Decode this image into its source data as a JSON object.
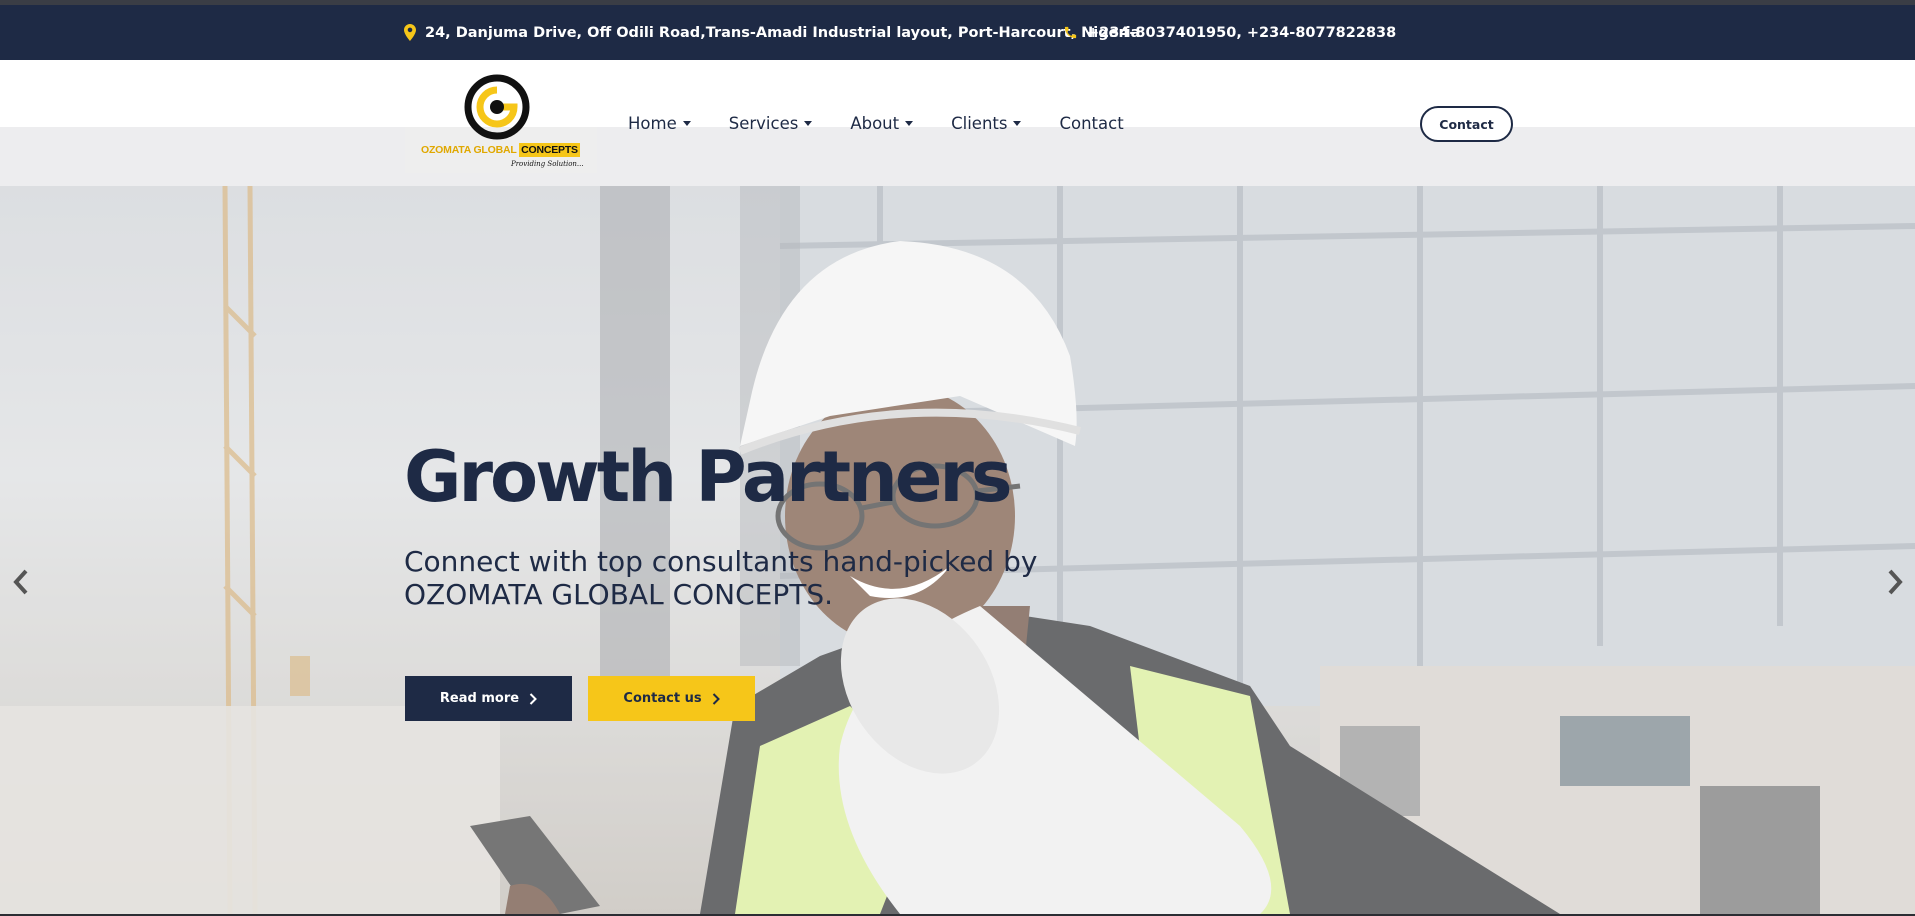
{
  "topbar": {
    "address": "24, Danjuma Drive, Off Odili Road,Trans-Amadi Industrial layout, Port-Harcourt, Nigeria",
    "address_icon": "map-pin-icon",
    "phone": "+234-8037401950, +234-8077822838",
    "phone_icon": "phone-icon"
  },
  "logo": {
    "name_part1": "OZOMATA GLOBAL ",
    "name_part2": "CONCEPTS",
    "tagline": "Providing Solution..."
  },
  "nav": {
    "items": [
      {
        "label": "Home",
        "dropdown": true
      },
      {
        "label": "Services",
        "dropdown": true
      },
      {
        "label": "About",
        "dropdown": true
      },
      {
        "label": "Clients",
        "dropdown": true
      },
      {
        "label": "Contact",
        "dropdown": false
      }
    ],
    "cta_label": "Contact"
  },
  "hero": {
    "title": "Growth Partners",
    "subtitle": "Connect with top consultants hand-picked by OZOMATA GLOBAL CONCEPTS.",
    "primary_button": "Read more",
    "secondary_button": "Contact us",
    "prev_icon": "chevron-left-icon",
    "next_icon": "chevron-right-icon"
  },
  "colors": {
    "navy": "#1e2a45",
    "yellow": "#f6c619",
    "white": "#ffffff"
  }
}
